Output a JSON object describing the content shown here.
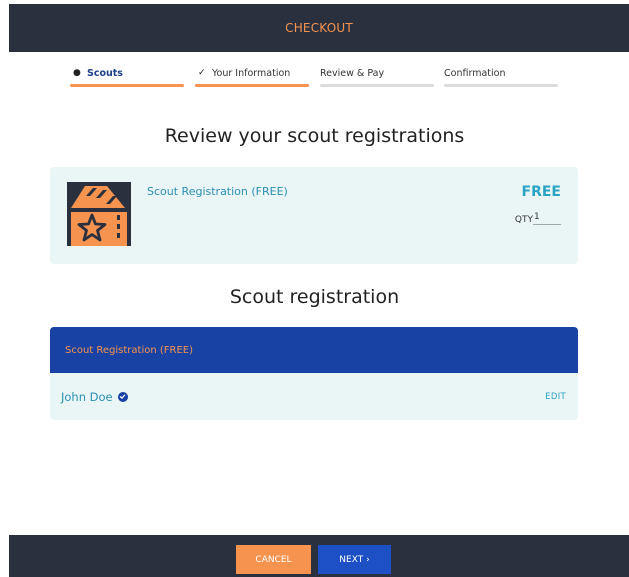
{
  "header": {
    "title": "CHECKOUT"
  },
  "stepper": {
    "steps": [
      {
        "label": "Scouts",
        "state": "active",
        "marker": "●"
      },
      {
        "label": "Your Information",
        "state": "done",
        "marker": "✓"
      },
      {
        "label": "Review & Pay",
        "state": "pending",
        "marker": ""
      },
      {
        "label": "Confirmation",
        "state": "pending",
        "marker": ""
      }
    ]
  },
  "review": {
    "heading": "Review your scout registrations",
    "item": {
      "name": "Scout Registration (FREE)",
      "price": "FREE",
      "qty_label": "QTY",
      "qty_value": "1",
      "icon": "ticket-star-icon"
    }
  },
  "registration": {
    "heading": "Scout registration",
    "card_title": "Scout Registration (FREE)",
    "person_name": "John Doe",
    "verified_icon": "check-circle-icon",
    "edit_label": "EDIT"
  },
  "footer": {
    "cancel_label": "CANCEL",
    "next_label": "NEXT ›"
  },
  "colors": {
    "dark_bar": "#2b303e",
    "accent_orange": "#f6934f",
    "primary_blue": "#1842a3",
    "teal_text": "#2b8fb3",
    "card_bg": "#eaf6f6"
  }
}
